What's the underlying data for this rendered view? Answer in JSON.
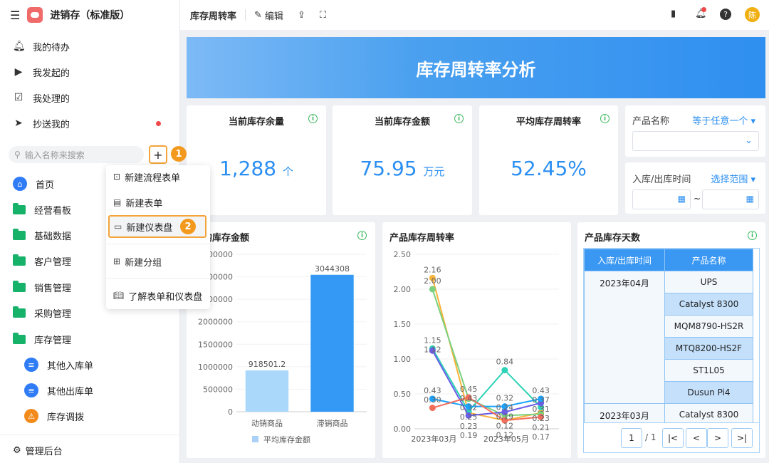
{
  "app": {
    "title": "进销存（标准版）"
  },
  "sidebar": {
    "items": [
      {
        "label": "我的待办",
        "icon": "bell-icon"
      },
      {
        "label": "我发起的",
        "icon": "play-icon"
      },
      {
        "label": "我处理的",
        "icon": "check-box-icon"
      },
      {
        "label": "抄送我的",
        "icon": "send-icon"
      }
    ],
    "search_placeholder": "输入名称来搜索",
    "home": "首页",
    "folders": [
      "经营看板",
      "基础数据",
      "客户管理",
      "销售管理",
      "采购管理",
      "库存管理"
    ],
    "subitems": [
      "其他入库单",
      "其他出库单",
      "库存调拨"
    ],
    "admin": "管理后台"
  },
  "menu": {
    "items": [
      "新建流程表单",
      "新建表单",
      "新建仪表盘",
      "新建分组",
      "了解表单和仪表盘"
    ]
  },
  "steps": [
    "1",
    "2"
  ],
  "topbar": {
    "title": "库存周转率",
    "edit": "编辑",
    "avatar": "陈"
  },
  "banner": {
    "title": "库存周转率分析"
  },
  "kpis": [
    {
      "title": "当前库存余量",
      "value": "1,288",
      "unit": "个"
    },
    {
      "title": "当前库存金额",
      "value": "75.95",
      "unit": "万元"
    },
    {
      "title": "平均库存周转率",
      "value": "52.45%",
      "unit": ""
    }
  ],
  "filters": {
    "product_label": "产品名称",
    "product_op": "等于任意一个",
    "date_label": "入库/出库时间",
    "date_op": "选择范围",
    "date_sep": "~"
  },
  "accent": "#2b8ff2",
  "chart_data": [
    {
      "type": "bar",
      "title": "平均库存金额",
      "categories": [
        "动销商品",
        "滞销商品"
      ],
      "values": [
        918501.2,
        3044308
      ],
      "value_labels": [
        "918501.2",
        "3044308"
      ],
      "ylim": [
        0,
        3500000
      ],
      "yticks": [
        "0",
        "500000",
        "1000000",
        "1500000",
        "2000000",
        "2500000",
        "3000000",
        "3500000"
      ],
      "legend": "平均库存金额",
      "legend_position": "bottom",
      "colors": [
        "#a9d8fb",
        "#3399f5"
      ],
      "grid": true
    },
    {
      "type": "line",
      "title": "产品库存周转率",
      "x": [
        "2023年03月",
        "2023年04月",
        "2023年05月",
        "2023年06月"
      ],
      "xticks_shown": [
        "2023年03月",
        "2023年05月"
      ],
      "ylim": [
        0,
        2.5
      ],
      "yticks": [
        "0.00",
        "0.50",
        "1.00",
        "1.50",
        "2.00",
        "2.50"
      ],
      "grid": true,
      "series": [
        {
          "color": "#f9b33a",
          "values": [
            2.16,
            0.23,
            0.12,
            0.23
          ]
        },
        {
          "color": "#7ad17f",
          "values": [
            2.0,
            0.43,
            0.19,
            0.21
          ]
        },
        {
          "color": "#2ed3b7",
          "values": [
            1.15,
            0.25,
            0.84,
            0.31
          ]
        },
        {
          "color": "#6a5ee8",
          "values": [
            1.12,
            0.19,
            0.24,
            0.37
          ]
        },
        {
          "color": "#1aa4ff",
          "values": [
            0.43,
            0.32,
            0.32,
            0.43
          ]
        },
        {
          "color": "#f36d5b",
          "values": [
            0.3,
            0.45,
            0.12,
            0.17
          ]
        }
      ]
    }
  ],
  "table": {
    "title": "产品库存天数",
    "headers": [
      "入库/出库时间",
      "产品名称"
    ],
    "groups": [
      {
        "date": "2023年04月",
        "products": [
          "UPS",
          "Catalyst 8300",
          "MQM8790-HS2R",
          "MTQ8200-HS2F",
          "ST1L05",
          "Dusun Pi4"
        ]
      },
      {
        "date": "2023年03月",
        "products": [
          "Catalyst 8300"
        ]
      }
    ],
    "page": "1",
    "total": "/ 1"
  }
}
